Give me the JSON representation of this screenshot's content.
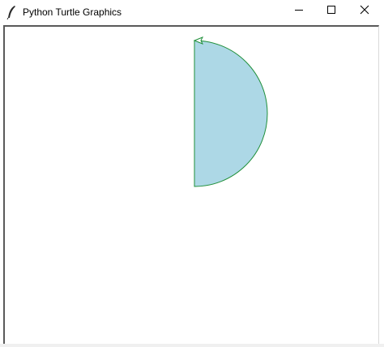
{
  "window": {
    "title": "Python Turtle Graphics",
    "icons": {
      "app": "feather-icon",
      "minimize": "minimize-icon",
      "maximize": "maximize-icon",
      "close": "close-icon"
    }
  },
  "canvas": {
    "background": "#ffffff",
    "shape": {
      "type": "half-circle",
      "fill_color": "#add8e6",
      "pen_color": "#1f8f3a"
    },
    "turtle": {
      "shape": "arrow",
      "heading": "west",
      "color": "#1f8f3a"
    }
  }
}
